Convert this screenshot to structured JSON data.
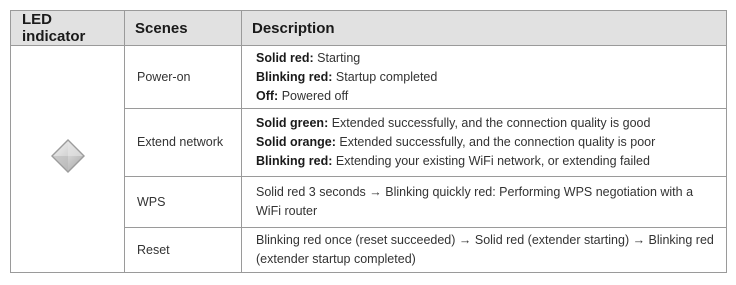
{
  "table": {
    "headers": {
      "led": "LED indicator",
      "scenes": "Scenes",
      "description": "Description"
    },
    "led_icon": "diamond-led-icon",
    "rows": [
      {
        "scene": "Power-on",
        "lines": [
          {
            "label": "Solid red:",
            "text": "Starting"
          },
          {
            "label": "Blinking red:",
            "text": "Startup completed"
          },
          {
            "label": "Off:",
            "text": "Powered off"
          }
        ]
      },
      {
        "scene": "Extend network",
        "lines": [
          {
            "label": "Solid green:",
            "text": "Extended successfully, and the connection quality is good"
          },
          {
            "label": "Solid orange:",
            "text": "Extended successfully, and the connection quality is poor"
          },
          {
            "label": "Blinking red:",
            "text": "Extending your existing WiFi network, or extending failed"
          }
        ]
      },
      {
        "scene": "WPS",
        "description": "Solid red 3 seconds → Blinking quickly red: Performing WPS negotiation with a WiFi router"
      },
      {
        "scene": "Reset",
        "description": "Blinking red once (reset succeeded) → Solid red (extender starting) → Blinking red (extender startup completed)"
      }
    ]
  }
}
